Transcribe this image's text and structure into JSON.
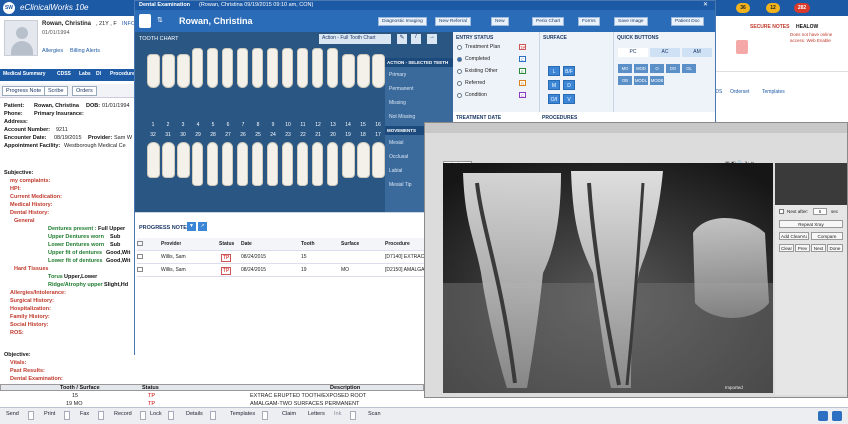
{
  "app": {
    "logo": "SW",
    "title": "eClinicalWorks 10e"
  },
  "patient": {
    "name": "Rowan, Christina",
    "age_sex": ", 21Y , F",
    "info_label": "INFO",
    "dob": "01/01/1994",
    "allergies": "Allergies",
    "billing": "Billing Alerts"
  },
  "nav": [
    "Medical Summary",
    "CDSS",
    "Labs",
    "DI",
    "Procedures"
  ],
  "left_toolbar": [
    "Progress Note",
    "Scribe",
    "Orders"
  ],
  "left_details": {
    "patient_label": "Patient:",
    "patient": "Rowan, Christina",
    "dob_label": "DOB:",
    "dob": "01/01/1994",
    "phone_label": "Phone:",
    "primary_ins_label": "Primary Insurance:",
    "address_label": "Address:",
    "account_label": "Account Number:",
    "account": "9211",
    "encounter_label": "Encounter Date:",
    "encounter": "08/19/2015",
    "provider_label": "Provider:",
    "provider": "Sam W",
    "facility_label": "Appointment Facility:",
    "facility": "Westborough Medical Ce"
  },
  "subjective": {
    "title": "Subjective:",
    "complaints": "my complaints:",
    "hpi": "HPI:",
    "meds": "Current Medication:",
    "medical": "Medical History:",
    "dental": "Dental History:",
    "general": "General",
    "dentures_present": "Dentures present :",
    "dentures_present_val": "Full Upper",
    "upper_worn": "Upper Dentures worn",
    "upper_worn_val": "Sub",
    "lower_worn": "Lower Dentures worn",
    "lower_worn_val": "Sub",
    "upper_fit": "Upper fit of dentures",
    "upper_fit_val": "Good,Wit",
    "lower_fit": "Lower fit of dentures",
    "lower_fit_val": "Good,Wit",
    "hard_tissues": "Hard Tissues",
    "torus": "Torus",
    "torus_val": "Upper,Lower",
    "ridge": "Ridge/Atrophy upper",
    "ridge_val": "Slight,Hd",
    "allergies": "Allergies/Intolerance:",
    "surgical": "Surgical History:",
    "hospitalization": "Hospitalization:",
    "family": "Family History:",
    "social": "Social History:",
    "ros": "ROS:"
  },
  "objective": {
    "title": "Objective:",
    "vitals": "Vitals:",
    "past_results": "Past Results:",
    "dental_exam": "Dental Examination:"
  },
  "bottom_table": {
    "headers": [
      "Tooth / Surface",
      "Status",
      "Description"
    ],
    "rows": [
      {
        "tooth": "15",
        "status": "TP",
        "desc": "EXTRAC ERUPTED TOOTH/EXPOSED ROOT"
      },
      {
        "tooth": "19 MO",
        "status": "TP",
        "desc": "AMALGAM-TWO SURFACES PERMANENT"
      }
    ]
  },
  "dental": {
    "title": "Dental Examination",
    "title_info": "(Rowan, Christina 09/19/2015 09:10 am, CON)",
    "patient_name": "Rowan, Christina",
    "header_buttons": [
      "Diagnostic Imaging",
      "New Referral",
      "New",
      "Perio Chart",
      "Forms",
      "Save Image",
      "Patient Doc"
    ],
    "tooth_chart_label": "TOOTH CHART",
    "chart_action": "Action - Full Tooth Chart",
    "upper_numbers": [
      "1",
      "2",
      "3",
      "4",
      "5",
      "6",
      "7",
      "8",
      "9",
      "10",
      "11",
      "12",
      "13",
      "14",
      "15",
      "16"
    ],
    "lower_numbers": [
      "32",
      "31",
      "30",
      "29",
      "28",
      "27",
      "26",
      "25",
      "24",
      "23",
      "22",
      "21",
      "20",
      "19",
      "18",
      "17"
    ],
    "action_head": "ACTION - SELECTED TEETH",
    "actions": [
      "Primary",
      "Permanent",
      "Missing",
      "Not Missing"
    ],
    "movements_head": "MOVEMENTS",
    "movements": [
      "Mesial",
      "Occlusal",
      "Labial",
      "Mesial Tip"
    ],
    "entry_status_head": "ENTRY STATUS",
    "entry_status": [
      {
        "label": "Treatment Plan",
        "badge": "TP",
        "selected": false
      },
      {
        "label": "Completed",
        "badge": "C",
        "selected": true
      },
      {
        "label": "Existing Other",
        "badge": "E",
        "selected": false
      },
      {
        "label": "Referred",
        "badge": "R",
        "selected": false
      },
      {
        "label": "Condition",
        "badge": "C",
        "selected": false
      }
    ],
    "treatment_date_head": "TREATMENT DATE",
    "surface_head": "SURFACE",
    "surfaces": [
      "L",
      "B/F",
      "M",
      "D",
      "O/I",
      "V"
    ],
    "procedures_head": "PROCEDURES",
    "quick_head": "QUICK BUTTONS",
    "quick_tabs": [
      "PC",
      "AC",
      "AM"
    ],
    "quick_buttons": [
      "MO",
      "MOD",
      "O",
      "DO",
      "OL",
      "OB",
      "MODL",
      "MODB"
    ],
    "progress_note_head": "PROGRESS NOTE",
    "pn_headers": [
      "Provider",
      "Status",
      "Date",
      "Tooth",
      "Surface",
      "Procedure"
    ],
    "pn_rows": [
      {
        "provider": "Willis, Sam",
        "status": "TP",
        "date": "08/24/2015",
        "tooth": "15",
        "surface": "",
        "procedure": "[D7140] EXTRAC E"
      },
      {
        "provider": "Willis, Sam",
        "status": "TP",
        "date": "08/24/2015",
        "tooth": "19",
        "surface": "MO",
        "procedure": "[D2150] AMALGA"
      }
    ]
  },
  "right_strip": {
    "badges": [
      "36",
      "12",
      "282"
    ],
    "secure_notes": "SECURE NOTES",
    "healow": "HEALOW",
    "healow_msg": "Does not have online access. Web Enable",
    "tabs": [
      "IDS",
      "Orderset",
      "Templates"
    ]
  },
  "xray": {
    "date": "10/19/2015",
    "footer": "Imported",
    "next_after_label": "Next after:",
    "next_after_value": "5",
    "seconds_label": "sec",
    "buttons": [
      "Repeat Xray",
      "Add ClearVu",
      "Compare",
      "Clear",
      "Prev",
      "Next",
      "Done"
    ]
  },
  "bottom_bar": [
    "Send",
    "Print",
    "Fax",
    "Record",
    "Lock",
    "Details",
    "Templates",
    "Claim",
    "Letters",
    "Ink",
    "Scan"
  ]
}
